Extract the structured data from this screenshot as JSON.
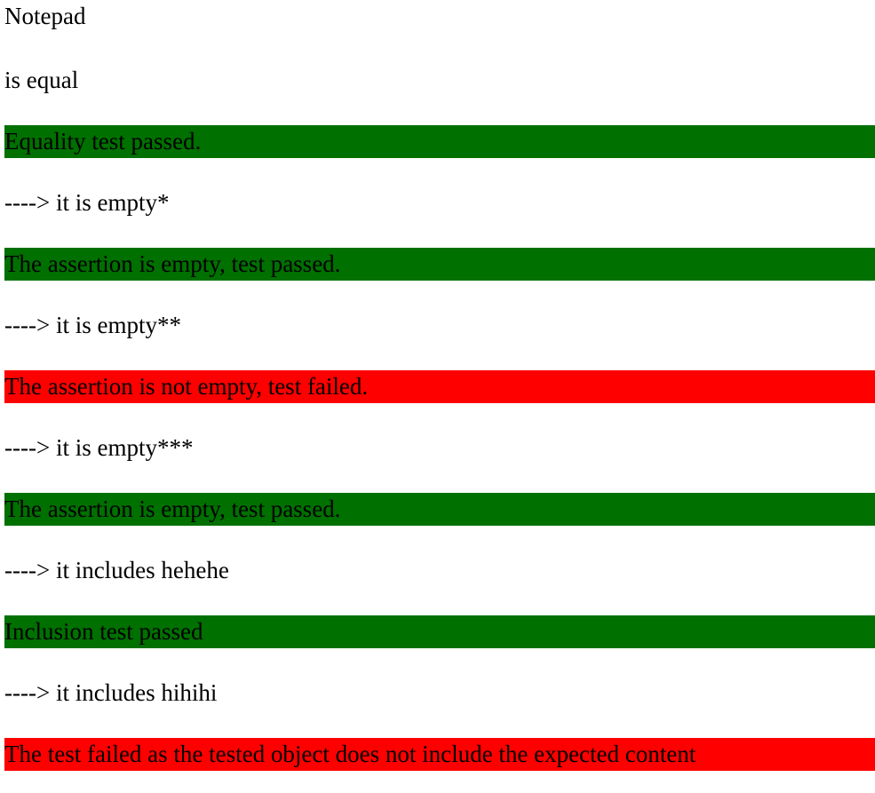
{
  "title": "Notepad",
  "heading": "is equal",
  "colors": {
    "pass": "#007000",
    "fail": "#ff0000",
    "text": "#000000",
    "background": "#ffffff"
  },
  "results": [
    {
      "label": "",
      "message": "Equality test passed.",
      "status": "pass"
    },
    {
      "label": "----> it is empty*",
      "message": "The assertion is empty, test passed.",
      "status": "pass"
    },
    {
      "label": "----> it is empty**",
      "message": "The assertion is not empty, test failed.",
      "status": "fail"
    },
    {
      "label": "----> it is empty***",
      "message": "The assertion is empty, test passed.",
      "status": "pass"
    },
    {
      "label": "----> it includes hehehe",
      "message": "Inclusion test passed",
      "status": "pass"
    },
    {
      "label": "----> it includes hihihi",
      "message": "The test failed as the tested object does not include the expected content",
      "status": "fail"
    }
  ]
}
